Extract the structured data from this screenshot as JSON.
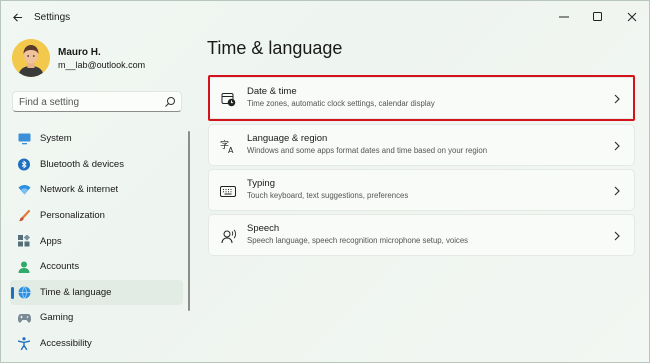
{
  "window": {
    "title": "Settings",
    "controls": [
      "minimize-icon",
      "maximize-icon",
      "close-icon"
    ]
  },
  "user": {
    "name": "Mauro H.",
    "email": "m__lab@outlook.com"
  },
  "search": {
    "placeholder": "Find a setting"
  },
  "sidebar": {
    "items": [
      {
        "label": "System",
        "icon": "monitor-icon",
        "active": false
      },
      {
        "label": "Bluetooth & devices",
        "icon": "bluetooth-icon",
        "active": false
      },
      {
        "label": "Network & internet",
        "icon": "wifi-icon",
        "active": false
      },
      {
        "label": "Personalization",
        "icon": "brush-icon",
        "active": false
      },
      {
        "label": "Apps",
        "icon": "apps-icon",
        "active": false
      },
      {
        "label": "Accounts",
        "icon": "person-icon",
        "active": false
      },
      {
        "label": "Time & language",
        "icon": "globe-clock-icon",
        "active": true
      },
      {
        "label": "Gaming",
        "icon": "gamepad-icon",
        "active": false
      },
      {
        "label": "Accessibility",
        "icon": "accessibility-icon",
        "active": false
      }
    ]
  },
  "main": {
    "title": "Time & language",
    "cards": [
      {
        "title": "Date & time",
        "description": "Time zones, automatic clock settings, calendar display",
        "icon": "calendar-clock-icon",
        "highlighted": true
      },
      {
        "title": "Language & region",
        "description": "Windows and some apps format dates and time based on your region",
        "icon": "language-icon",
        "highlighted": false
      },
      {
        "title": "Typing",
        "description": "Touch keyboard, text suggestions, preferences",
        "icon": "keyboard-icon",
        "highlighted": false
      },
      {
        "title": "Speech",
        "description": "Speech language, speech recognition microphone setup, voices",
        "icon": "speech-icon",
        "highlighted": false
      }
    ]
  },
  "colors": {
    "accent": "#1f6fc0",
    "highlight_border": "#d4121b"
  }
}
